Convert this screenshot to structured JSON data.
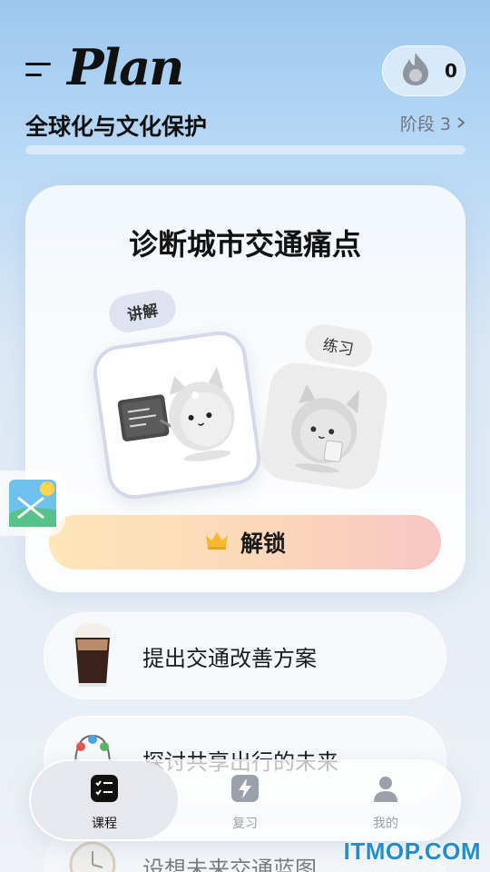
{
  "header": {
    "logo_text": "Plan",
    "streak_count": "0",
    "course_title": "全球化与文化保护",
    "stage_label": "阶段 3",
    "progress_fraction": 0.0
  },
  "main_card": {
    "title": "诊断城市交通痛点",
    "tag_lecture": "讲解",
    "tag_practice": "练习",
    "unlock_label": "解锁"
  },
  "lessons": [
    {
      "name": "提出交通改善方案",
      "icon": "iced-coffee-icon"
    },
    {
      "name": "探讨共享出行的未来",
      "icon": "bead-maze-toy-icon"
    },
    {
      "name": "设想未来交通蓝图",
      "icon": "clock-icon"
    }
  ],
  "bottom_nav": [
    {
      "label": "课程",
      "icon": "checklist-icon",
      "active": true
    },
    {
      "label": "复习",
      "icon": "lightning-icon",
      "active": false
    },
    {
      "label": "我的",
      "icon": "profile-icon",
      "active": false
    }
  ],
  "watermark": "ITMOP.COM",
  "colors": {
    "accent_blue": "#6fa8dc",
    "unlock_gradient_start": "#fde6b8",
    "unlock_gradient_end": "#f8c6c4",
    "watermark": "#1e8fd6"
  }
}
